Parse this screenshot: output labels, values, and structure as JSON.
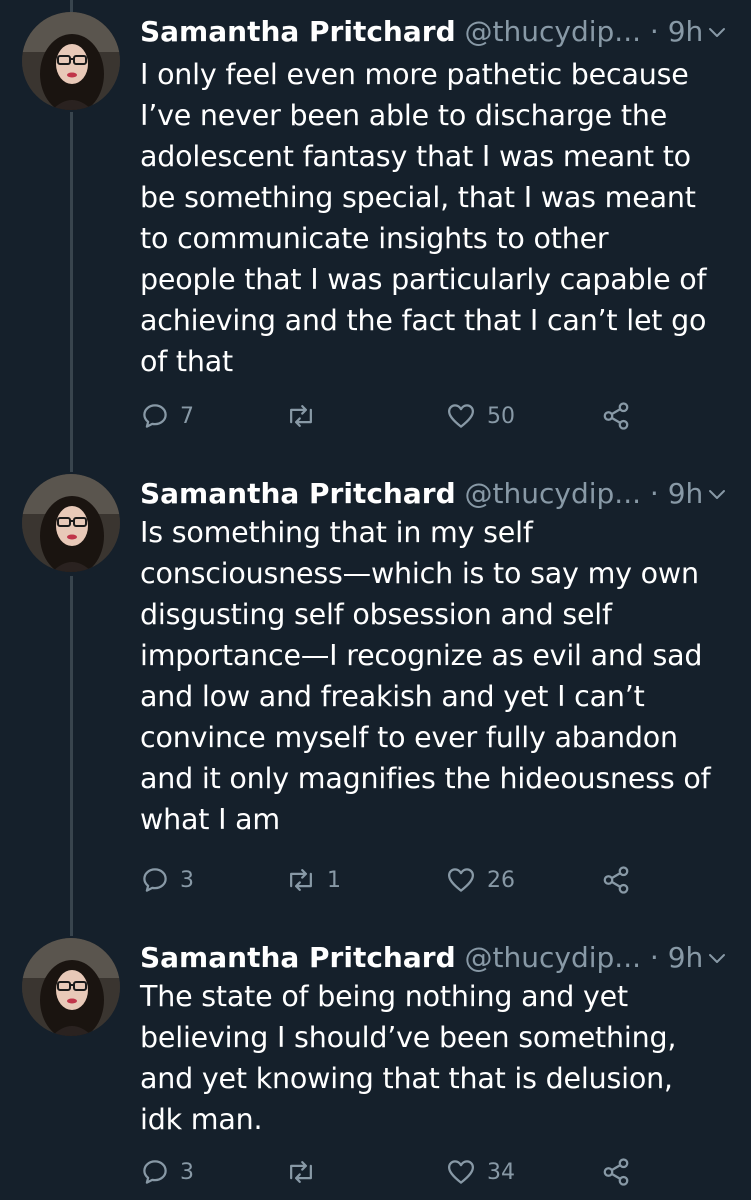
{
  "theme": {
    "background": "#15202b",
    "text_primary": "#ffffff",
    "text_secondary": "#8899a6",
    "thread_line": "#38444d"
  },
  "tweets": [
    {
      "author": {
        "name": "Samantha Pritchard",
        "handle": "@thucydip...",
        "avatar_icon": "avatar-photo"
      },
      "separator": "·",
      "time": "9h",
      "text": "I only feel even more pathetic because\nI’ve never been able to discharge the\nadolescent fantasy that I was meant to\nbe something special, that I was meant\nto communicate insights to other\npeople that I was particularly capable of\nachieving and the fact that I can’t let go\nof that",
      "stats": {
        "replies": "7",
        "retweets": "",
        "likes": "50"
      }
    },
    {
      "author": {
        "name": "Samantha Pritchard",
        "handle": "@thucydip...",
        "avatar_icon": "avatar-photo"
      },
      "separator": "·",
      "time": "9h",
      "text": "Is something that in my self\nconsciousness—which is to say my own\ndisgusting self obsession and self\nimportance—I recognize as evil and sad\nand low and freakish and yet I can’t\nconvince myself to ever fully abandon\nand it only magnifies the hideousness of\nwhat I am",
      "stats": {
        "replies": "3",
        "retweets": "1",
        "likes": "26"
      }
    },
    {
      "author": {
        "name": "Samantha Pritchard",
        "handle": "@thucydip...",
        "avatar_icon": "avatar-photo"
      },
      "separator": "·",
      "time": "9h",
      "text": "The state of being nothing and yet\nbelieving I should’ve been something,\nand yet knowing that that is delusion,\nidk man.",
      "stats": {
        "replies": "3",
        "retweets": "",
        "likes": "34"
      }
    }
  ],
  "icons": {
    "reply": "reply-icon",
    "retweet": "retweet-icon",
    "like": "heart-icon",
    "share": "share-icon",
    "menu": "chevron-down-icon"
  }
}
